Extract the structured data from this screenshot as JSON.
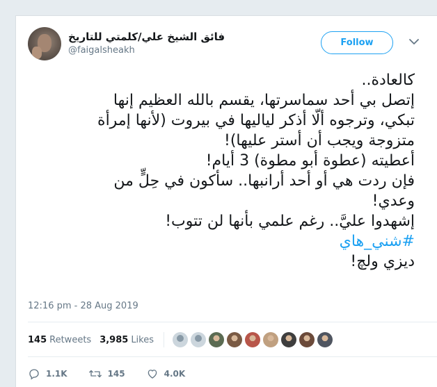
{
  "author": {
    "display_name": "فائق الشيخ علي/كلمتي للتاريخ",
    "handle": "@faigalsheakh",
    "avatar_icon": "avatar-photo"
  },
  "follow_label": "Follow",
  "tweet": {
    "lines": [
      "كالعادة..",
      "إتصل بي أحد سماسرتها، يقسم بالله العظيم إنها",
      "تبكي، وترجوه ألّا أذكر لياليها في بيروت (لأنها إمرأة",
      "متزوجة ويجب أن أستر عليها)!",
      "أعطيته (عطوة أبو مطوة) 3 أيام!",
      "فإن ردت هي أو أحد أرانبها.. سأكون في حِلٍّ من",
      "وعدي!",
      "إشهدوا عليَّ.. رغم علمي بأنها لن تتوب!"
    ],
    "hashtag": "#شني_هاي",
    "last_line": "ديزي ولچ!"
  },
  "timestamp": "12:16 pm - 28 Aug 2019",
  "stats": {
    "retweets_count": "145",
    "retweets_label": "Retweets",
    "likes_count": "3,985",
    "likes_label": "Likes"
  },
  "likers": [
    {
      "color": "#ccd6dd",
      "default": true
    },
    {
      "color": "#ccd6dd",
      "default": true
    },
    {
      "color": "#5b6b52",
      "default": false
    },
    {
      "color": "#7a5a44",
      "default": false
    },
    {
      "color": "#b8564a",
      "default": false
    },
    {
      "color": "#c0a080",
      "default": false
    },
    {
      "color": "#3e3e3e",
      "default": false
    },
    {
      "color": "#6b4a3a",
      "default": false
    },
    {
      "color": "#4f5560",
      "default": false
    }
  ],
  "actions": {
    "reply_count": "1.1K",
    "retweet_count": "145",
    "like_count": "4.0K"
  },
  "colors": {
    "accent": "#1da1f2",
    "muted": "#657786",
    "text": "#14171a",
    "background": "#e6ecf0"
  }
}
